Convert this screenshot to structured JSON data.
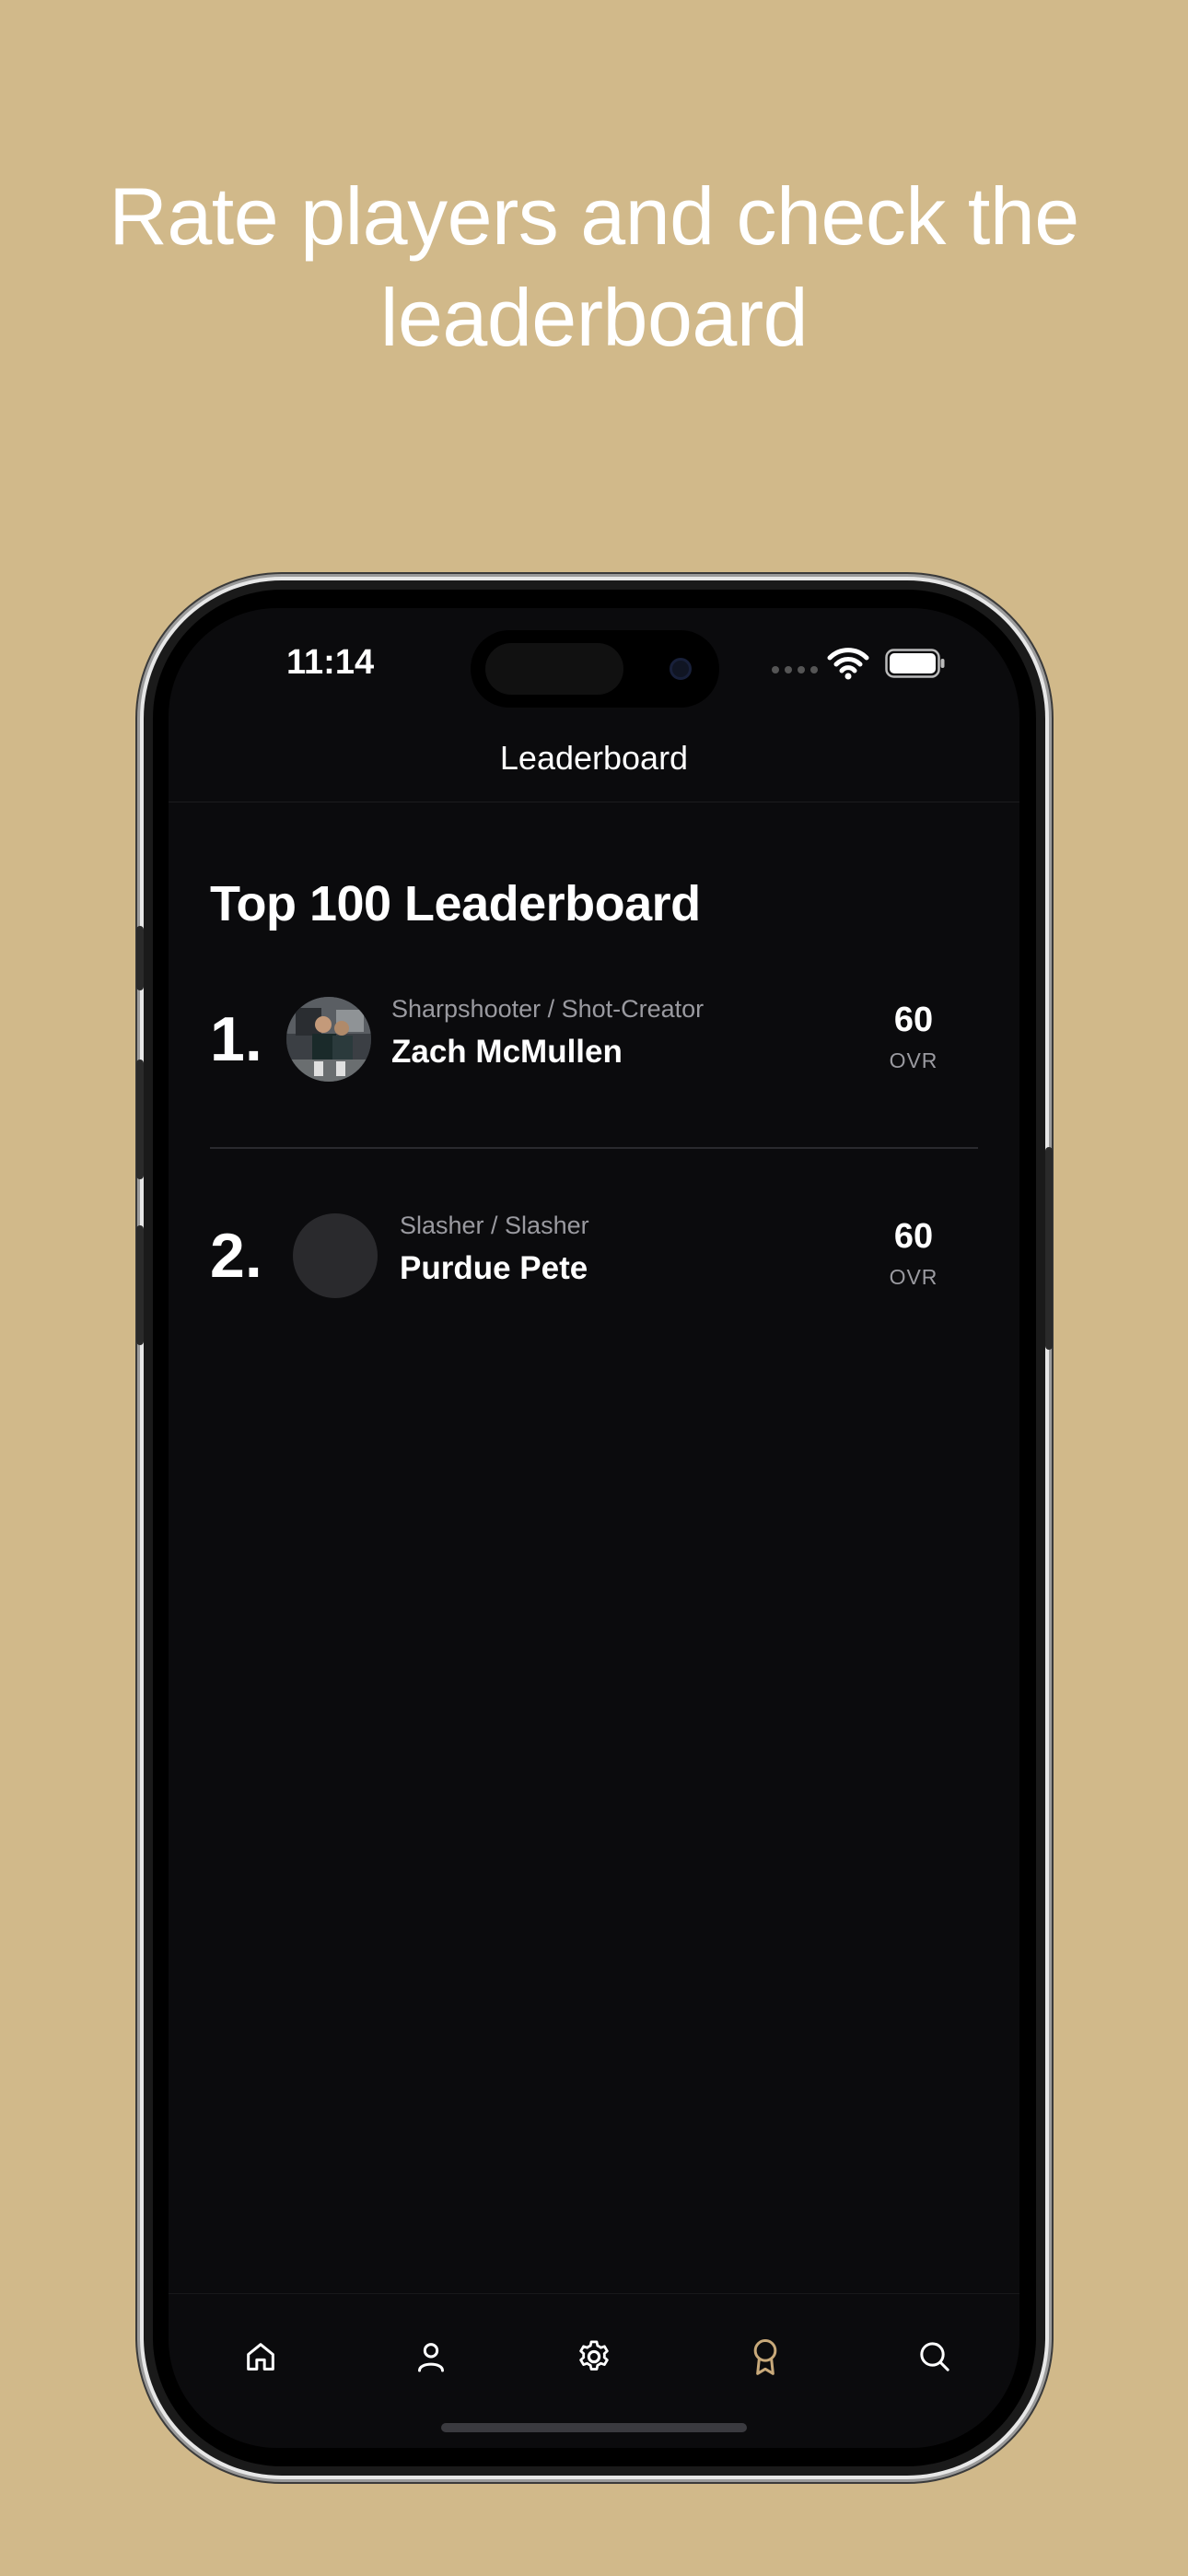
{
  "headline": {
    "line1": "Rate players and check the",
    "line2": "leaderboard"
  },
  "status_bar": {
    "time": "11:14"
  },
  "nav": {
    "title": "Leaderboard"
  },
  "section": {
    "title": "Top 100 Leaderboard"
  },
  "leaderboard": [
    {
      "rank": "1.",
      "position": "Sharpshooter / Shot-Creator",
      "name": "Zach McMullen",
      "score": "60",
      "score_label": "OVR"
    },
    {
      "rank": "2.",
      "position": "Slasher / Slasher",
      "name": "Purdue Pete",
      "score": "60",
      "score_label": "OVR"
    }
  ],
  "tabs": [
    {
      "icon": "home-icon",
      "active": false
    },
    {
      "icon": "person-icon",
      "active": false
    },
    {
      "icon": "gear-icon",
      "active": false
    },
    {
      "icon": "award-icon",
      "active": true
    },
    {
      "icon": "search-icon",
      "active": false
    }
  ],
  "colors": {
    "background": "#D1B98A",
    "screen": "#0B0B0D",
    "accent": "#C8A97A",
    "text": "#FFFFFF",
    "muted": "#9A9AA0"
  }
}
